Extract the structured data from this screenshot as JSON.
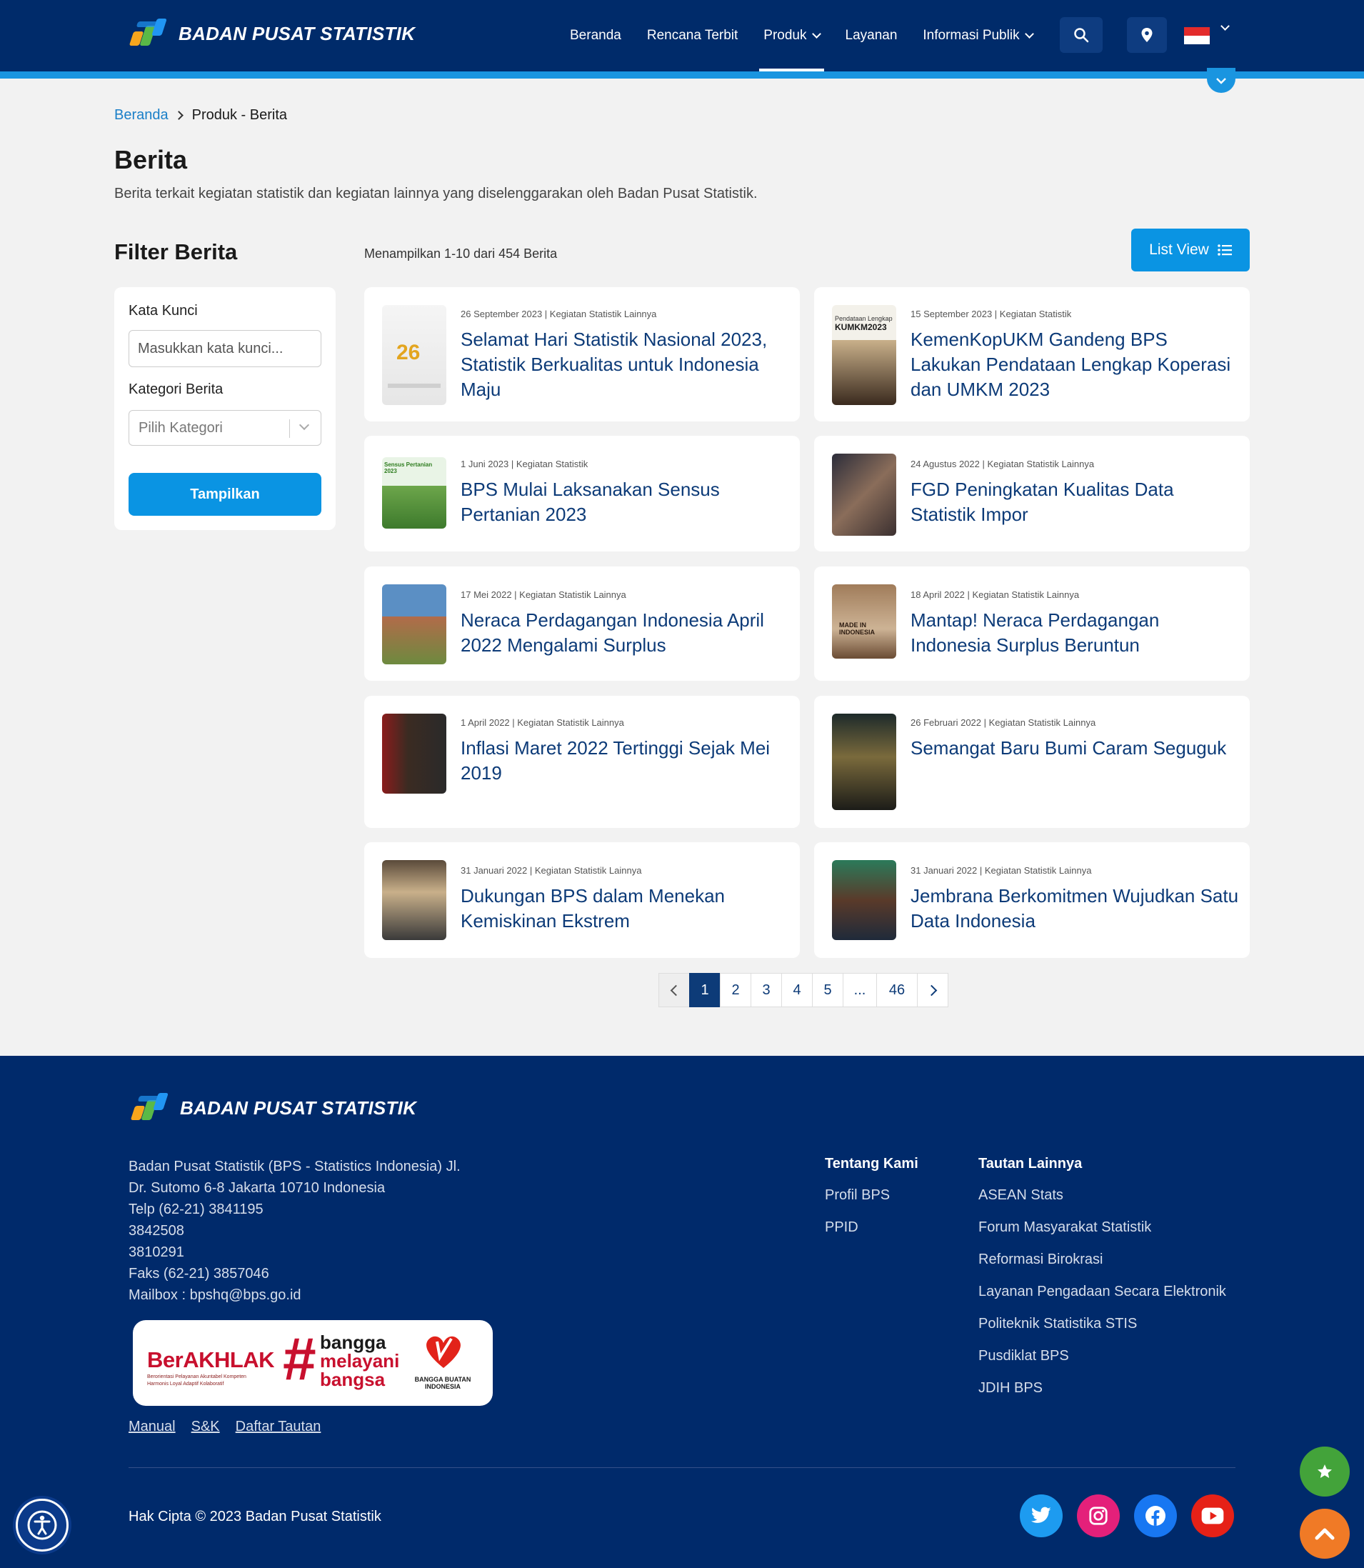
{
  "header": {
    "brand": "BADAN PUSAT STATISTIK",
    "nav": [
      {
        "label": "Beranda"
      },
      {
        "label": "Rencana Terbit"
      },
      {
        "label": "Produk"
      },
      {
        "label": "Layanan"
      },
      {
        "label": "Informasi Publik"
      }
    ],
    "active_nav": "Produk"
  },
  "breadcrumb": {
    "home": "Beranda",
    "current": "Produk - Berita"
  },
  "page": {
    "title": "Berita",
    "description": "Berita terkait kegiatan statistik dan kegiatan lainnya yang diselenggarakan oleh Badan Pusat Statistik."
  },
  "filter": {
    "title": "Filter Berita",
    "keyword_label": "Kata Kunci",
    "keyword_placeholder": "Masukkan kata kunci...",
    "category_label": "Kategori Berita",
    "category_placeholder": "Pilih Kategori",
    "submit_label": "Tampilkan"
  },
  "listing": {
    "count_text": "Menampilkan 1-10 dari 454 Berita",
    "view_button": "List View"
  },
  "news": [
    {
      "meta": "26 September 2023 | Kegiatan Statistik Lainnya",
      "title": "Selamat Hari Statistik Nasional 2023, Statistik Berkualitas untuk Indonesia Maju"
    },
    {
      "meta": "15 September 2023 | Kegiatan Statistik",
      "title": "KemenKopUKM Gandeng BPS Lakukan Pendataan Lengkap Koperasi dan UMKM 2023"
    },
    {
      "meta": "1 Juni 2023 | Kegiatan Statistik",
      "title": "BPS Mulai Laksanakan Sensus Pertanian 2023"
    },
    {
      "meta": "24 Agustus 2022 | Kegiatan Statistik Lainnya",
      "title": "FGD Peningkatan Kualitas Data Statistik Impor"
    },
    {
      "meta": "17 Mei 2022 | Kegiatan Statistik Lainnya",
      "title": "Neraca Perdagangan Indonesia April 2022 Mengalami Surplus"
    },
    {
      "meta": "18 April 2022 | Kegiatan Statistik Lainnya",
      "title": "Mantap! Neraca Perdagangan Indonesia Surplus Beruntun"
    },
    {
      "meta": "1 April 2022 | Kegiatan Statistik Lainnya",
      "title": "Inflasi Maret 2022 Tertinggi Sejak Mei 2019"
    },
    {
      "meta": "26 Februari 2022 | Kegiatan Statistik Lainnya",
      "title": "Semangat Baru Bumi Caram Seguguk"
    },
    {
      "meta": "31 Januari 2022 | Kegiatan Statistik Lainnya",
      "title": "Dukungan BPS dalam Menekan Kemiskinan Ekstrem"
    },
    {
      "meta": "31 Januari 2022 | Kegiatan Statistik Lainnya",
      "title": "Jembrana Berkomitmen Wujudkan Satu Data Indonesia"
    }
  ],
  "thumb_text": {
    "card2": "KUMKM2023",
    "card2_small": "Pendataan Lengkap",
    "card3": "Sensus Pertanian 2023",
    "card6": "MADE IN INDONESIA"
  },
  "pagination": {
    "pages": [
      "1",
      "2",
      "3",
      "4",
      "5",
      "...",
      "46"
    ],
    "current": "1"
  },
  "footer": {
    "brand": "BADAN PUSAT STATISTIK",
    "address_lines": [
      "Badan Pusat Statistik (BPS - Statistics Indonesia) Jl.",
      "Dr. Sutomo 6-8 Jakarta 10710 Indonesia",
      "Telp (62-21) 3841195",
      "3842508",
      "3810291",
      "Faks (62-21) 3857046",
      "Mailbox : bpshq@bps.go.id"
    ],
    "banner": {
      "berakhlak": "BerAKHLAK",
      "berakhlak_sub1": "Berorientasi Pelayanan Akuntabel Kompeten",
      "berakhlak_sub2": "Harmonis Loyal Adaptif Kolaboratif",
      "hash": "#",
      "bangga1": "bangga",
      "bangga2": "melayani",
      "bangga3": "bangsa",
      "bbi": "BANGGA BUATAN",
      "bbi2": "INDONESIA"
    },
    "bottom_links": [
      "Manual",
      "S&K",
      "Daftar Tautan"
    ],
    "col1_title": "Tentang Kami",
    "col1_items": [
      "Profil BPS",
      "PPID"
    ],
    "col2_title": "Tautan Lainnya",
    "col2_items": [
      "ASEAN Stats",
      "Forum Masyarakat Statistik",
      "Reformasi Birokrasi",
      "Layanan Pengadaan Secara Elektronik",
      "Politeknik Statistika STIS",
      "Pusdiklat BPS",
      "JDIH BPS"
    ],
    "copyright": "Hak Cipta © 2023 Badan Pusat Statistik"
  },
  "colors": {
    "navy": "#002b6a",
    "accent_blue": "#0a94e3",
    "title_blue": "#0d3b78",
    "twitter": "#1d9bf0",
    "instagram": "#e4207a",
    "facebook": "#1877f2",
    "youtube": "#e62117"
  }
}
